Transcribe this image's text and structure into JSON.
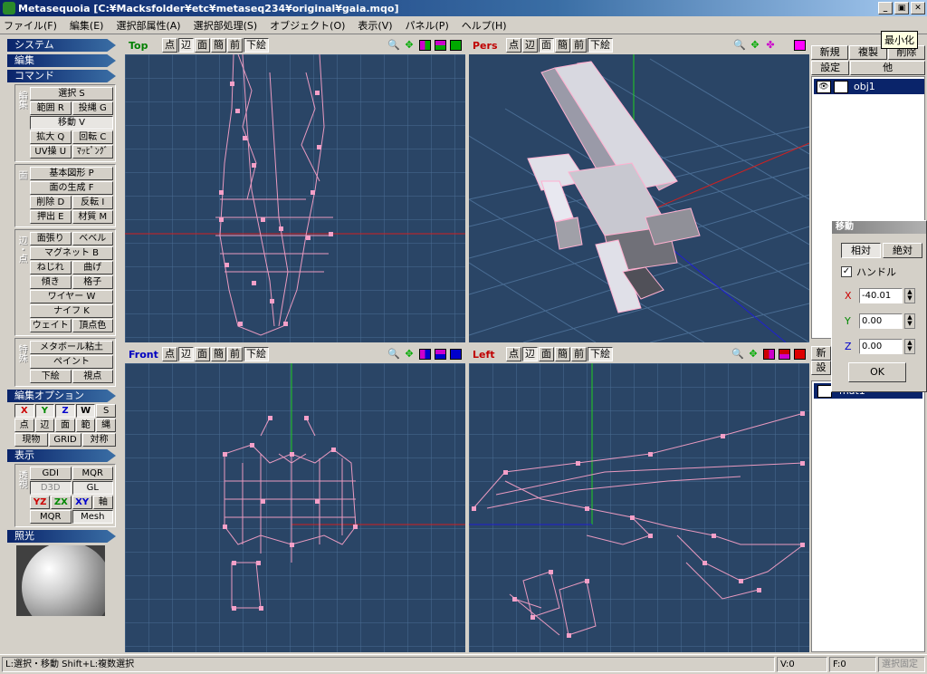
{
  "window": {
    "title": "Metasequoia [C:¥Macksfolder¥etc¥metaseq234¥original¥gaia.mqo]",
    "btn_min": "_",
    "btn_max": "▣",
    "btn_close": "✕"
  },
  "menu": [
    "ファイル(F)",
    "編集(E)",
    "選択部属性(A)",
    "選択部処理(S)",
    "オブジェクト(O)",
    "表示(V)",
    "パネル(P)",
    "ヘルプ(H)"
  ],
  "left": {
    "sec_system": "システム",
    "sec_edit": "編集",
    "sec_command": "コマンド",
    "grp_edit_label": "編集",
    "edit_rows": [
      [
        "選択 S"
      ],
      [
        "範囲 R",
        "投縄 G"
      ],
      [
        "移動 V"
      ],
      [
        "拡大 Q",
        "回転 C"
      ],
      [
        "UV操 U",
        "ﾏｯﾋﾟﾝｸﾞ"
      ]
    ],
    "grp_face_label": "面",
    "face_rows": [
      [
        "基本図形 P"
      ],
      [
        "面の生成 F"
      ],
      [
        "削除 D",
        "反転 I"
      ],
      [
        "押出 E",
        "材質 M"
      ]
    ],
    "grp_vert_label": "辺・点",
    "vert_rows": [
      [
        "面張り",
        "ベベル"
      ],
      [
        "マグネット B"
      ],
      [
        "ねじれ",
        "曲げ"
      ],
      [
        "傾き",
        "格子"
      ],
      [
        "ワイヤー W"
      ],
      [
        "ナイフ K"
      ],
      [
        "ウェイト",
        "頂点色"
      ]
    ],
    "grp_special_label": "特殊",
    "special_rows": [
      [
        "メタボール粘土"
      ],
      [
        "ペイント"
      ],
      [
        "下絵",
        "視点"
      ]
    ],
    "sec_editopt": "編集オプション",
    "opt_row1": [
      "X",
      "Y",
      "Z",
      "W",
      "S"
    ],
    "opt_row2": [
      "点",
      "辺",
      "面",
      "範",
      "縄"
    ],
    "opt_row3": [
      "現物",
      "GRID",
      "対称"
    ],
    "sec_display": "表示",
    "disp_label": "透視",
    "disp_row1": [
      "GDI",
      "MQR"
    ],
    "disp_row2": [
      "D3D",
      "GL"
    ],
    "disp_row3": [
      "YZ",
      "ZX",
      "XY",
      "軸"
    ],
    "disp_row4": [
      "MQR",
      "Mesh"
    ],
    "sec_light": "照光"
  },
  "viewports": {
    "top": {
      "name": "Top",
      "name_color": "#008000"
    },
    "pers": {
      "name": "Pers",
      "name_color": "#c00000"
    },
    "front": {
      "name": "Front",
      "name_color": "#0000c0"
    },
    "left": {
      "name": "Left",
      "name_color": "#c00000"
    },
    "buttons": [
      "点",
      "辺",
      "面",
      "簡",
      "前",
      "下絵"
    ]
  },
  "right": {
    "tooltip": "最小化",
    "row1": [
      "新規",
      "複製",
      "削除"
    ],
    "row2": [
      "設定",
      "他"
    ],
    "object_name": "obj1",
    "row3": [
      "新",
      "設"
    ],
    "material_name": "mat1"
  },
  "move_dialog": {
    "title": "移動",
    "tab_relative": "相対",
    "tab_absolute": "絶対",
    "handle_label": "ハンドル",
    "x_label": "X",
    "x_value": "-40.01",
    "y_label": "Y",
    "y_value": "0.00",
    "z_label": "Z",
    "z_value": "0.00",
    "ok": "OK"
  },
  "status": {
    "hint": "L:選択・移動 Shift+L:複数選択",
    "v": "V:0",
    "f": "F:0",
    "lock": "選択固定"
  }
}
